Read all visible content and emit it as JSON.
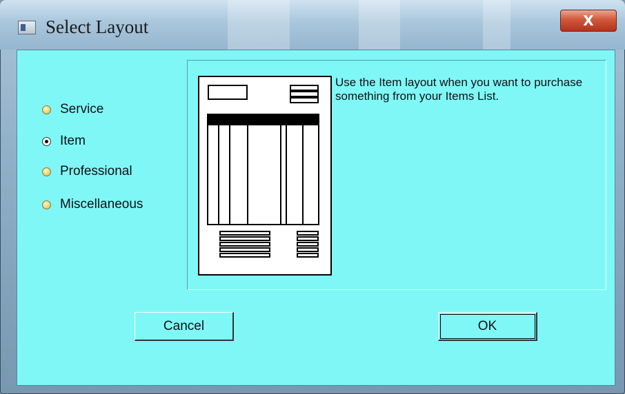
{
  "window": {
    "title": "Select Layout",
    "close_glyph": "X",
    "icon": "window-app-icon"
  },
  "layout_options": [
    {
      "label": "Service",
      "selected": false
    },
    {
      "label": "Item",
      "selected": true
    },
    {
      "label": "Professional",
      "selected": false
    },
    {
      "label": "Miscellaneous",
      "selected": false
    }
  ],
  "preview": {
    "description": "Use the Item layout when you want to purchase something from your Items List."
  },
  "buttons": {
    "cancel": "Cancel",
    "ok": "OK"
  },
  "colors": {
    "dialog_background": "#7ff7f7",
    "close_button": "#d2583c"
  }
}
